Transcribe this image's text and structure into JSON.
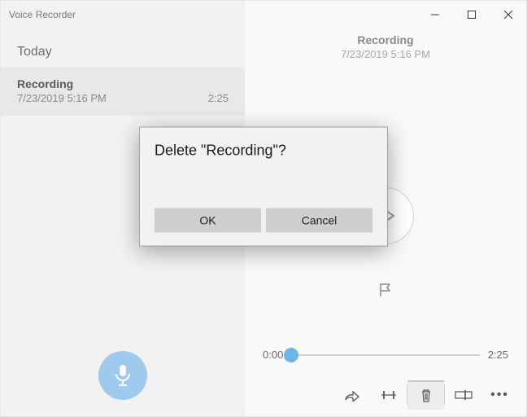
{
  "app_title": "Voice Recorder",
  "sidebar": {
    "section": "Today",
    "items": [
      {
        "title": "Recording",
        "date": "7/23/2019 5:16 PM",
        "duration": "2:25"
      }
    ]
  },
  "detail": {
    "title": "Recording",
    "date": "7/23/2019 5:16 PM",
    "current_time": "0:00",
    "total_time": "2:25"
  },
  "dialog": {
    "title": "Delete \"Recording\"?",
    "ok": "OK",
    "cancel": "Cancel"
  }
}
